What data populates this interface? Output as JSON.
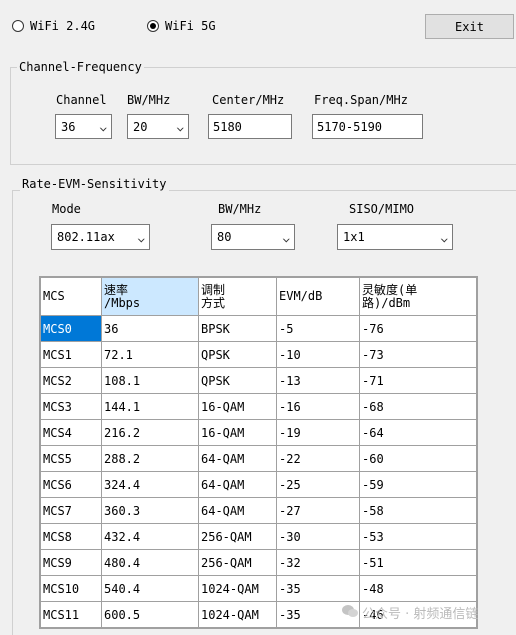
{
  "bands": {
    "wifi24": {
      "label": "WiFi 2.4G",
      "checked": false
    },
    "wifi5": {
      "label": "WiFi 5G",
      "checked": true
    }
  },
  "exit_label": "Exit",
  "channel_group": {
    "title": "Channel-Frequency",
    "channel_label": "Channel",
    "channel_value": "36",
    "bw_label": "BW/MHz",
    "bw_value": "20",
    "center_label": "Center/MHz",
    "center_value": "5180",
    "span_label": "Freq.Span/MHz",
    "span_value": "5170-5190"
  },
  "rate_group": {
    "title": "Rate-EVM-Sensitivity",
    "mode_label": "Mode",
    "mode_value": "802.11ax",
    "bw_label": "BW/MHz",
    "bw_value": "80",
    "siso_label": "SISO/MIMO",
    "siso_value": "1x1"
  },
  "table": {
    "headers": [
      "MCS",
      "速率\n/Mbps",
      "调制\n方式",
      "EVM/dB",
      "灵敏度(单\n路)/dBm"
    ],
    "rows": [
      [
        "MCS0",
        "36",
        "BPSK",
        "-5",
        "-76"
      ],
      [
        "MCS1",
        "72.1",
        "QPSK",
        "-10",
        "-73"
      ],
      [
        "MCS2",
        "108.1",
        "QPSK",
        "-13",
        "-71"
      ],
      [
        "MCS3",
        "144.1",
        "16-QAM",
        "-16",
        "-68"
      ],
      [
        "MCS4",
        "216.2",
        "16-QAM",
        "-19",
        "-64"
      ],
      [
        "MCS5",
        "288.2",
        "64-QAM",
        "-22",
        "-60"
      ],
      [
        "MCS6",
        "324.4",
        "64-QAM",
        "-25",
        "-59"
      ],
      [
        "MCS7",
        "360.3",
        "64-QAM",
        "-27",
        "-58"
      ],
      [
        "MCS8",
        "432.4",
        "256-QAM",
        "-30",
        "-53"
      ],
      [
        "MCS9",
        "480.4",
        "256-QAM",
        "-32",
        "-51"
      ],
      [
        "MCS10",
        "540.4",
        "1024-QAM",
        "-35",
        "-48"
      ],
      [
        "MCS11",
        "600.5",
        "1024-QAM",
        "-35",
        "-46"
      ]
    ]
  },
  "watermark": "公众号 · 射频通信链"
}
